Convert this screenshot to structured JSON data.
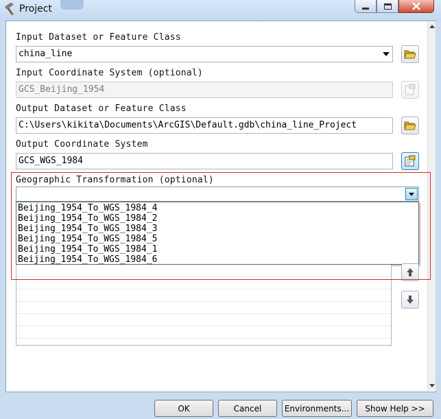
{
  "window": {
    "title": "Project",
    "minimize_label": "minimize",
    "maximize_label": "maximize",
    "close_label": "close"
  },
  "form": {
    "input_dataset": {
      "label": "Input Dataset or Feature Class",
      "value": "china_line"
    },
    "input_coord": {
      "label": "Input Coordinate System (optional)",
      "value": "GCS_Beijing_1954"
    },
    "output_dataset": {
      "label": "Output Dataset or Feature Class",
      "value": "C:\\Users\\kikita\\Documents\\ArcGIS\\Default.gdb\\china_line_Project"
    },
    "output_coord": {
      "label": "Output Coordinate System",
      "value": "GCS_WGS_1984"
    },
    "geo_transform": {
      "label": "Geographic Transformation (optional)",
      "value": "",
      "options": [
        "Beijing_1954_To_WGS_1984_4",
        "Beijing_1954_To_WGS_1984_2",
        "Beijing_1954_To_WGS_1984_3",
        "Beijing_1954_To_WGS_1984_5",
        "Beijing_1954_To_WGS_1984_1",
        "Beijing_1954_To_WGS_1984_6"
      ]
    }
  },
  "buttons": {
    "ok": "OK",
    "cancel": "Cancel",
    "environments": "Environments...",
    "show_help": "Show Help >>"
  },
  "colors": {
    "highlight": "#d42a2a",
    "folder": "#e8b830",
    "arrow_blue": "#3c7fb1"
  },
  "icons": {
    "title": "hammer-icon",
    "browse": "folder-open-icon",
    "coord": "spatial-reference-icon",
    "up": "arrow-up-icon",
    "down": "arrow-down-icon"
  }
}
